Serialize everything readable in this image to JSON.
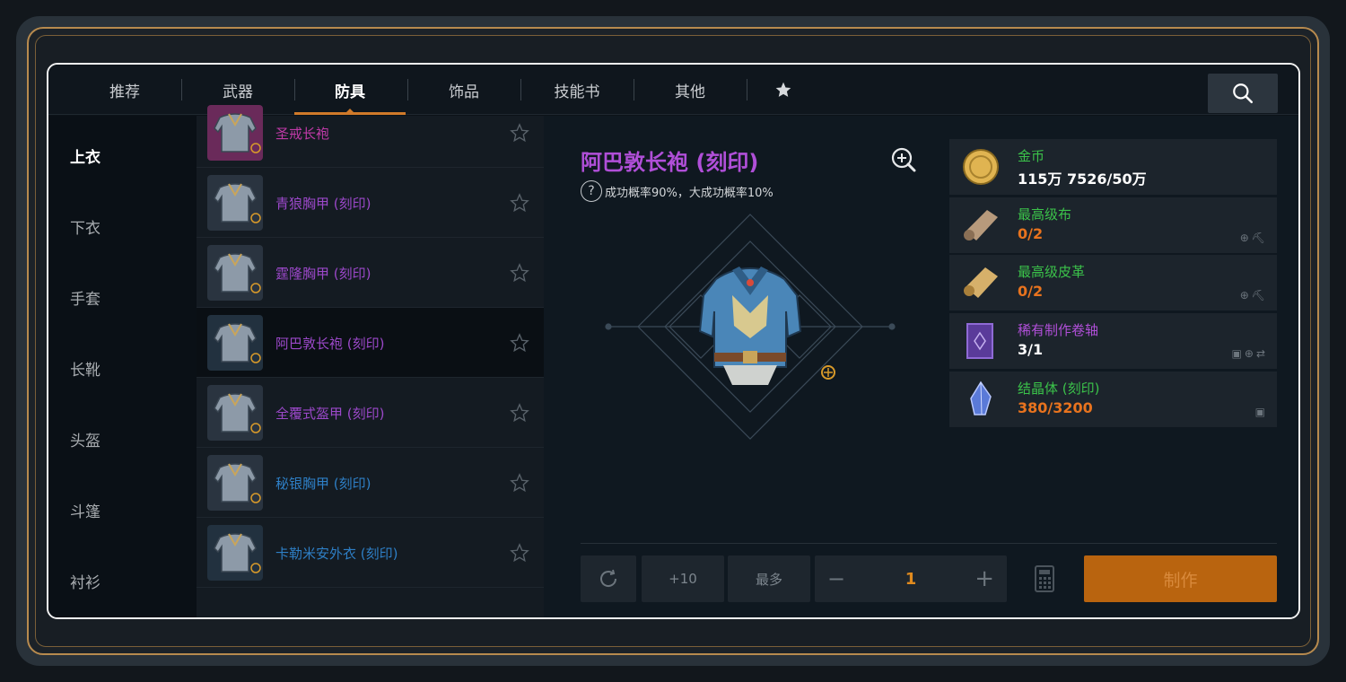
{
  "tabs": [
    {
      "label": "推荐"
    },
    {
      "label": "武器"
    },
    {
      "label": "防具"
    },
    {
      "label": "饰品"
    },
    {
      "label": "技能书"
    },
    {
      "label": "其他"
    }
  ],
  "categories": [
    {
      "label": "上衣"
    },
    {
      "label": "下衣"
    },
    {
      "label": "手套"
    },
    {
      "label": "长靴"
    },
    {
      "label": "头盔"
    },
    {
      "label": "斗篷"
    },
    {
      "label": "衬衫"
    }
  ],
  "items": [
    {
      "name": "圣戒长袍",
      "color": "#c03aa8"
    },
    {
      "name": "青狼胸甲 (刻印)",
      "color": "#9b48c9"
    },
    {
      "name": "霆隆胸甲 (刻印)",
      "color": "#9b48c9"
    },
    {
      "name": "阿巴敦长袍 (刻印)",
      "color": "#9b48c9"
    },
    {
      "name": "全覆式盔甲 (刻印)",
      "color": "#9b48c9"
    },
    {
      "name": "秘银胸甲 (刻印)",
      "color": "#2e7fc6"
    },
    {
      "name": "卡勒米安外衣 (刻印)",
      "color": "#2e7fc6"
    }
  ],
  "detail": {
    "title": "阿巴敦长袍 (刻印)",
    "subtitle": "成功概率90%，大成功概率10%",
    "help": "?"
  },
  "materials": [
    {
      "name": "金币",
      "count": "115万 7526/50万",
      "name_color": "#3bc24a",
      "count_color": "#ffffff",
      "controls": ""
    },
    {
      "name": "最高级布",
      "count": "0/2",
      "name_color": "#3bc24a",
      "count_color": "#e8731e",
      "controls": "⊕⛏"
    },
    {
      "name": "最高级皮革",
      "count": "0/2",
      "name_color": "#3bc24a",
      "count_color": "#e8731e",
      "controls": "⊕⛏"
    },
    {
      "name": "稀有制作卷轴",
      "count": "3/1",
      "name_color": "#b04fd8",
      "count_color": "#ffffff",
      "controls": "▣⊕⇄"
    },
    {
      "name": "结晶体 (刻印)",
      "count": "380/3200",
      "name_color": "#3bc24a",
      "count_color": "#e8731e",
      "controls": "▣"
    }
  ],
  "controls": {
    "plus10": "+10",
    "max": "最多",
    "minus": "−",
    "quantity": "1",
    "plus": "+",
    "craft": "制作"
  },
  "colors": {
    "accent": "#d07a2a",
    "craft_bg": "#b9640f",
    "epic": "#b04fd8",
    "rare": "#2e7fc6"
  }
}
